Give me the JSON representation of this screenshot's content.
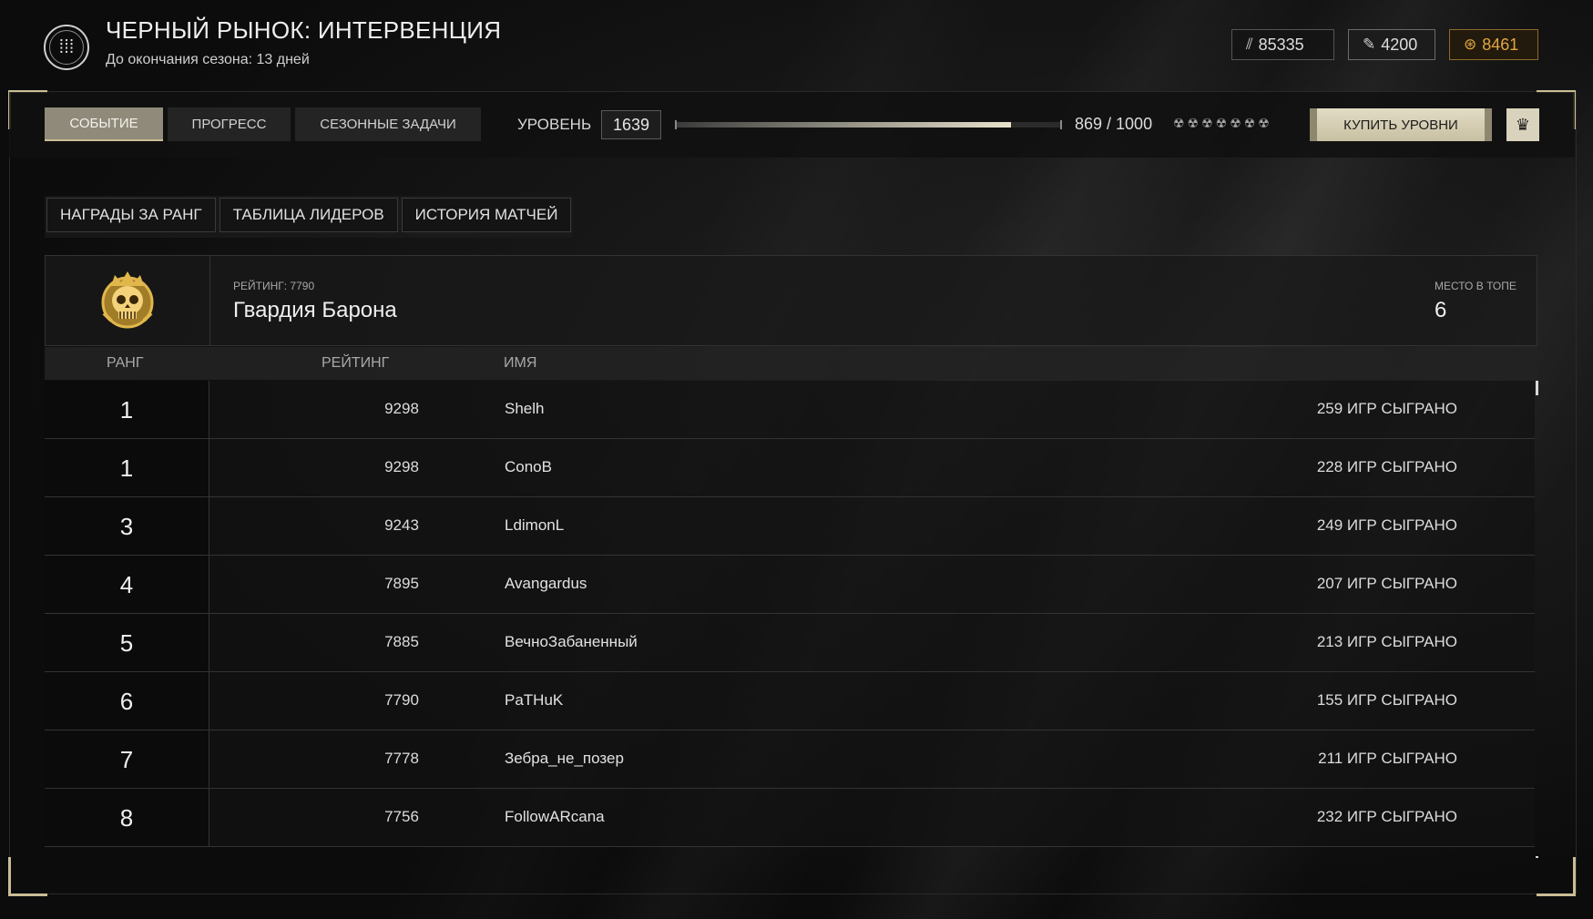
{
  "header": {
    "title": "ЧЕРНЫЙ РЫНОК: ИНТЕРВЕНЦИЯ",
    "subtitle": "До окончания сезона: 13 дней",
    "currencies": [
      {
        "icon": "ammo-currency-icon",
        "value": "85335"
      },
      {
        "icon": "ticket-currency-icon",
        "value": "4200"
      },
      {
        "icon": "gold-coin-icon",
        "value": "8461",
        "color": "#e2a640"
      }
    ]
  },
  "nav": {
    "tabs": [
      {
        "label": "СОБЫТИЕ",
        "active": true
      },
      {
        "label": "ПРОГРЕСС",
        "active": false
      },
      {
        "label": "СЕЗОННЫЕ ЗАДАЧИ",
        "active": false
      }
    ],
    "level_label": "УРОВЕНЬ",
    "level_value": "1639",
    "progress_text": "869 / 1000",
    "progress_fraction": 0.869,
    "stars": "☢☢☢☢☢☢☢",
    "buy_label": "КУПИТЬ УРОВНИ",
    "crown_icon": "crown-icon"
  },
  "subtabs": [
    "НАГРАДЫ ЗА РАНГ",
    "ТАБЛИЦА ЛИДЕРОВ",
    "ИСТОРИЯ МАТЧЕЙ"
  ],
  "team": {
    "rating_label": "РЕЙТИНГ: 7790",
    "name": "Гвардия Барона",
    "place_label": "МЕСТО В ТОПЕ",
    "place_value": "6",
    "emblem_icon": "skull-emblem-icon"
  },
  "table": {
    "headers": {
      "rank": "РАНГ",
      "rating": "РЕЙТИНГ",
      "name": "ИМЯ"
    },
    "rows": [
      {
        "rank": "1",
        "rating": "9298",
        "name": "Shelh",
        "games": "259 ИГР СЫГРАНО"
      },
      {
        "rank": "1",
        "rating": "9298",
        "name": "ConoB",
        "games": "228 ИГР СЫГРАНО"
      },
      {
        "rank": "3",
        "rating": "9243",
        "name": "LdimonL",
        "games": "249 ИГР СЫГРАНО"
      },
      {
        "rank": "4",
        "rating": "7895",
        "name": "Avangardus",
        "games": "207 ИГР СЫГРАНО"
      },
      {
        "rank": "5",
        "rating": "7885",
        "name": "ВечноЗабаненный",
        "games": "213 ИГР СЫГРАНО"
      },
      {
        "rank": "6",
        "rating": "7790",
        "name": "PaTHuK",
        "games": "155 ИГР СЫГРАНО"
      },
      {
        "rank": "7",
        "rating": "7778",
        "name": "Зебра_не_позер",
        "games": "211 ИГР СЫГРАНО"
      },
      {
        "rank": "8",
        "rating": "7756",
        "name": "FollowARcana",
        "games": "232 ИГР СЫГРАНО"
      }
    ]
  }
}
